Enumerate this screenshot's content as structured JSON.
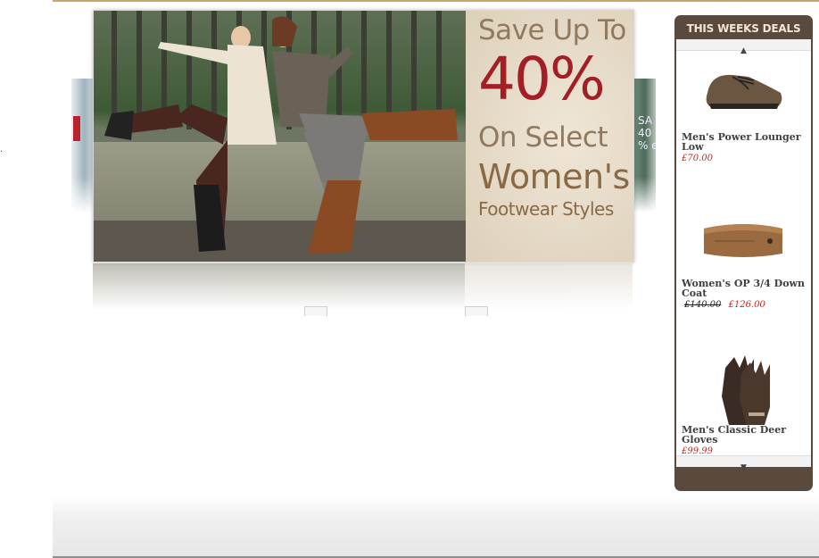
{
  "banner": {
    "line1": "Save Up To",
    "line2": "40%",
    "line3": "On Select",
    "line4": "Women's",
    "line5": "Footwear Styles"
  },
  "side_slides": {
    "right_text": "SA\n40\n% e"
  },
  "deals": {
    "title": "THIS WEEKS DEALS",
    "up_arrow": "▲",
    "down_arrow": "▼",
    "items": [
      {
        "name": "Men's Power Lounger Low",
        "price": "£70.00",
        "icon": "shoe-icon"
      },
      {
        "name": "Women's OP 3/4 Down Coat",
        "old_price": "£140.00",
        "price": "£126.00",
        "icon": "belt-icon"
      },
      {
        "name": "Men's Classic Deer Gloves",
        "price": "£99.99",
        "icon": "gloves-icon"
      }
    ]
  },
  "stray_mark": ".",
  "colors": {
    "accent_brown": "#5a4a3e",
    "price_red": "#c42525",
    "banner_red": "#a11f25"
  }
}
